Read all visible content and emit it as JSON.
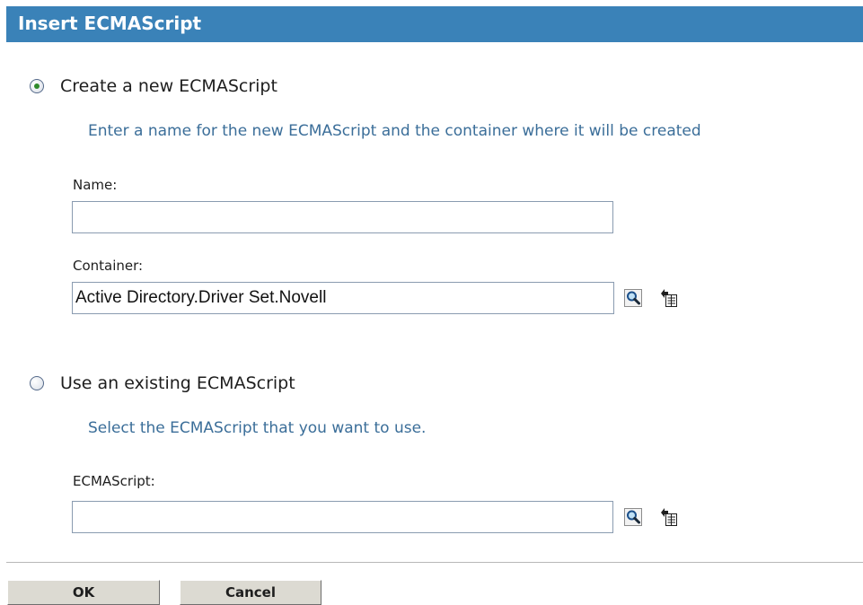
{
  "dialog": {
    "title": "Insert ECMAScript"
  },
  "create_new": {
    "option_label": "Create a new ECMAScript",
    "selected": true,
    "hint": "Enter a name for the new ECMAScript and the container where it will be created",
    "name_label": "Name:",
    "name_value": "",
    "container_label": "Container:",
    "container_value": "Active Directory.Driver Set.Novell"
  },
  "use_existing": {
    "option_label": "Use an existing ECMAScript",
    "selected": false,
    "hint": "Select the ECMAScript that you want to use.",
    "script_label": "ECMAScript:",
    "script_value": ""
  },
  "icons": {
    "browse": "magnifier-search-icon",
    "history": "object-history-icon"
  },
  "buttons": {
    "ok_label": "OK",
    "cancel_label": "Cancel"
  },
  "colors": {
    "title_bar": "#3a82b8",
    "hint_text": "#3b6e99",
    "radio_dot": "#2f8a2a",
    "button_face": "#dcdad2"
  }
}
